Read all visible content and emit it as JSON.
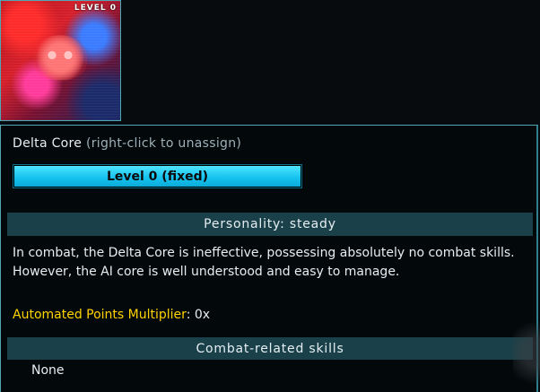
{
  "portrait": {
    "badge": "LEVEL 0",
    "icon": "ai-core-portrait"
  },
  "core": {
    "name": "Delta Core",
    "hint": "(right-click to unassign)"
  },
  "level_button": {
    "label": "Level 0 (fixed)",
    "color": "#1bc6f2"
  },
  "personality": {
    "label": "Personality: steady"
  },
  "description": {
    "text": "In combat, the Delta Core is ineffective, possessing absolutely no combat skills. However, the AI core is well understood and easy to manage."
  },
  "multiplier": {
    "label": "Automated Points Multiplier",
    "sep": ": ",
    "value": "0x",
    "color": "#ffd400"
  },
  "skills": {
    "header": "Combat-related skills",
    "items": [
      "None"
    ]
  }
}
